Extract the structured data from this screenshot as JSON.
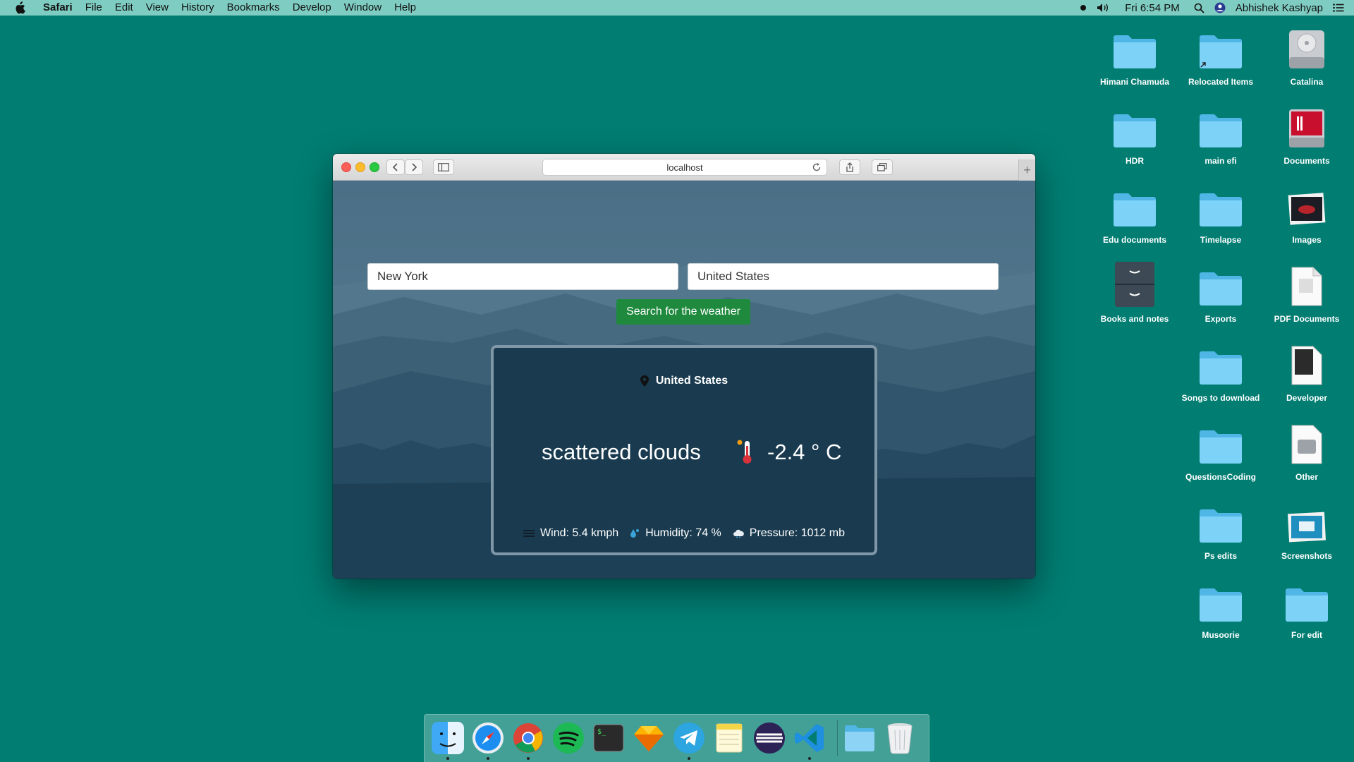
{
  "menubar": {
    "app_name": "Safari",
    "items": [
      "File",
      "Edit",
      "View",
      "History",
      "Bookmarks",
      "Develop",
      "Window",
      "Help"
    ],
    "clock": "Fri 6:54 PM",
    "user": "Abhishek Kashyap"
  },
  "browser": {
    "url": "localhost"
  },
  "weather_app": {
    "city_value": "New York",
    "country_value": "United States",
    "search_button": "Search for the weather",
    "location": "United States",
    "description": "scattered clouds",
    "temperature": "-2.4 ° C",
    "wind": "Wind: 5.4 kmph",
    "humidity": "Humidity: 74 %",
    "pressure": "Pressure: 1012 mb",
    "colors": {
      "button": "#1f8a3e",
      "card": "#193a4f",
      "card_border": "#7f97a6"
    }
  },
  "desktop": {
    "background_color": "#017d72",
    "icons": [
      "Himani Chamuda",
      "Relocated Items",
      "Catalina",
      "HDR",
      "main efi",
      "Documents",
      "Edu documents",
      "Timelapse",
      "Images",
      "Books and notes",
      "Exports",
      "PDF Documents",
      "Songs to download",
      "Developer",
      "QuestionsCoding",
      "Other",
      "Ps edits",
      "Screenshots",
      "Musoorie",
      "For edit"
    ]
  },
  "dock": {
    "apps": [
      "finder-icon",
      "safari-icon",
      "chrome-icon",
      "spotify-icon",
      "terminal-icon",
      "sketch-icon",
      "telegram-icon",
      "notes-icon",
      "eclipse-icon",
      "vscode-icon",
      "downloads-folder-icon",
      "trash-icon"
    ]
  }
}
